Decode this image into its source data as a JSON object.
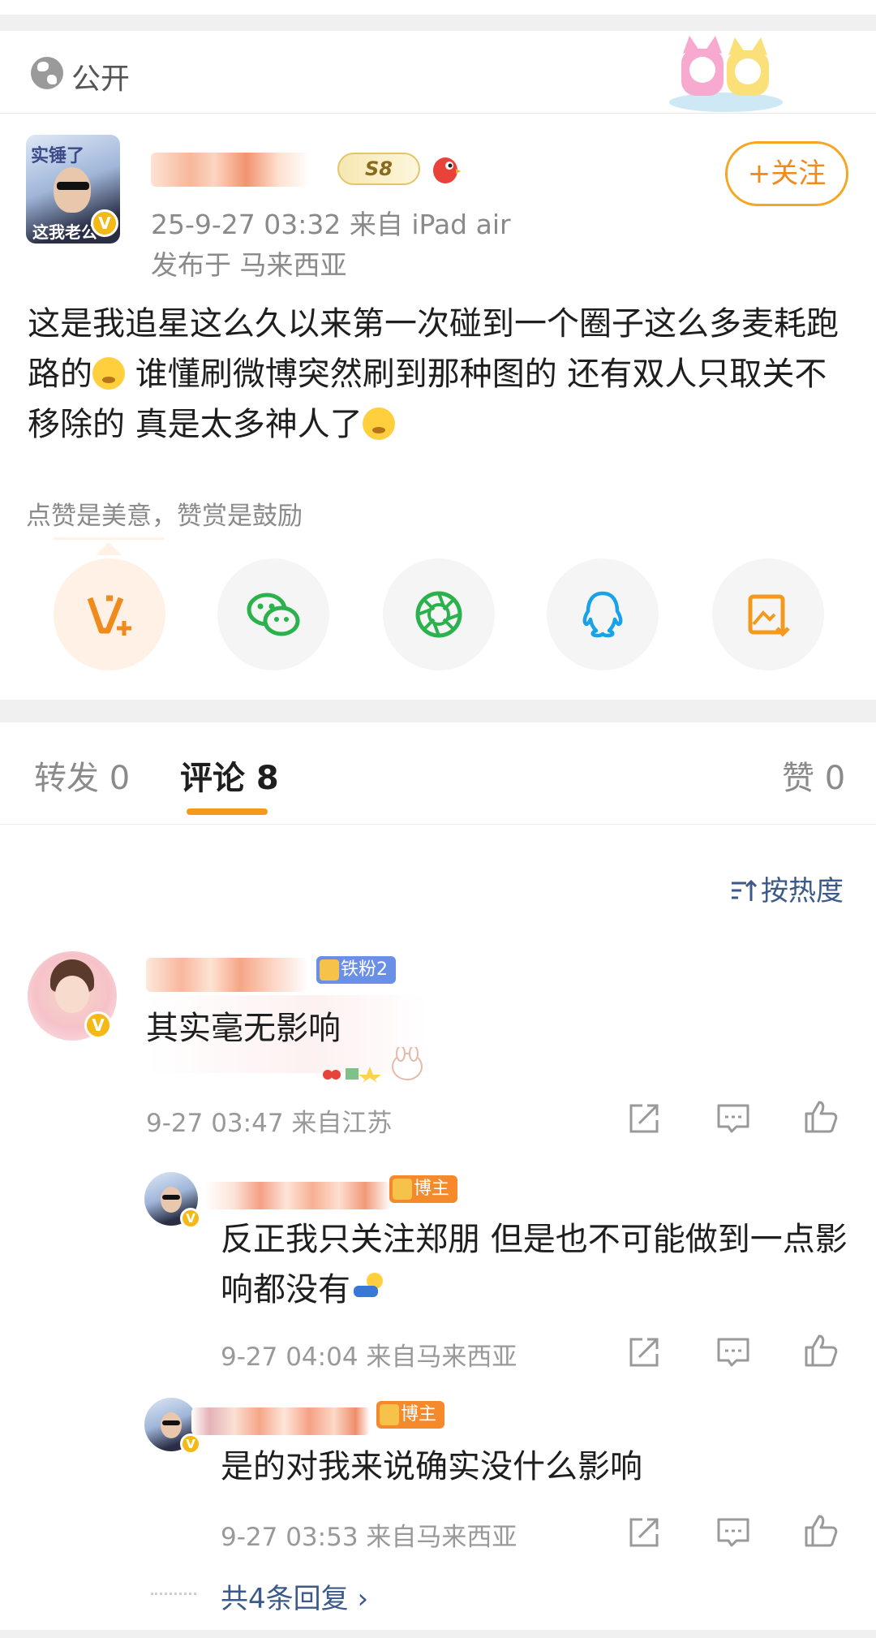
{
  "top_bar": {
    "visibility_label": "公开"
  },
  "post": {
    "level_badge": "S8",
    "timestamp_source": "25-9-27 03:32  来自 iPad air",
    "location": "发布于 马来西亚",
    "follow_label": "+关注",
    "text_part1": "这是我追星这么久以来第一次碰到一个圈子这么多麦耗跑路的",
    "text_part2": " 谁懂刷微博突然刷到那种图的 还有双人只取关不移除的 真是太多神人了",
    "avatar_caption_top": "实锤了",
    "avatar_caption_bottom": "这我老公",
    "reward_tip": "点赞是美意，赞赏是鼓励"
  },
  "share_buttons": [
    {
      "icon": "reward-v-icon"
    },
    {
      "icon": "wechat-icon"
    },
    {
      "icon": "moments-icon"
    },
    {
      "icon": "qq-icon"
    },
    {
      "icon": "save-image-icon"
    }
  ],
  "tabs": {
    "repost": "转发 0",
    "comments": "评论 8",
    "likes": "赞 0"
  },
  "sort_label": "按热度",
  "comments": [
    {
      "tag": "铁粉2",
      "text": "其实毫无影响",
      "meta": "9-27 03:47  来自江苏"
    }
  ],
  "replies": [
    {
      "tag": "博主",
      "text": "反正我只关注郑朋 但是也不可能做到一点影响都没有",
      "meta": "9-27 04:04  来自马来西亚"
    },
    {
      "tag": "博主",
      "text": "是的对我来说确实没什么影响",
      "meta": "9-27 03:53  来自马来西亚"
    }
  ],
  "more_replies_label": "共4条回复 ›",
  "colors": {
    "accent_orange": "#f39a1d",
    "link_blue": "#3b5a8a",
    "vip_yellow": "#f5b917"
  }
}
